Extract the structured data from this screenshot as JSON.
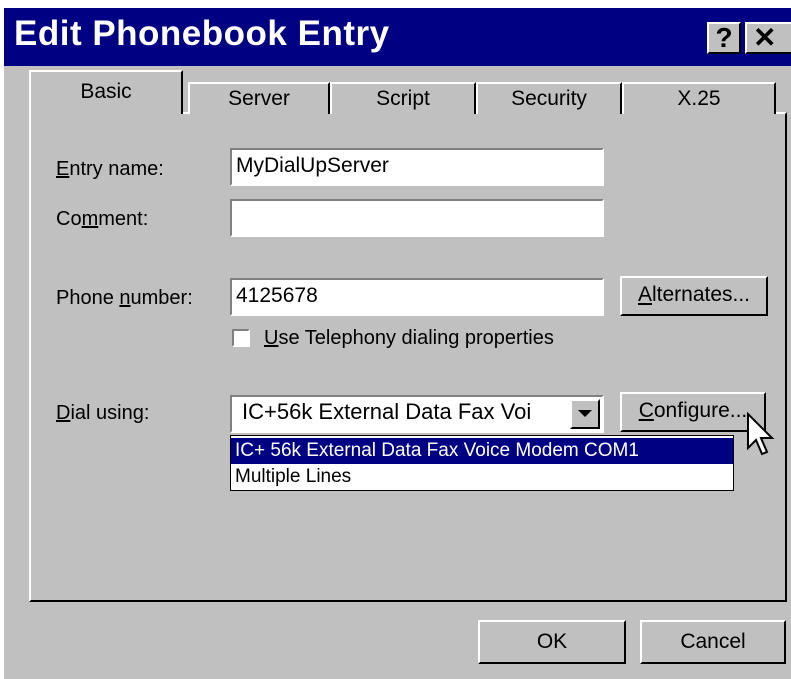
{
  "window": {
    "title": "Edit Phonebook Entry",
    "help_label": "?",
    "close_label": "✕"
  },
  "tabs": [
    {
      "label": "Basic",
      "active": true
    },
    {
      "label": "Server"
    },
    {
      "label": "Script"
    },
    {
      "label": "Security"
    },
    {
      "label": "X.25"
    }
  ],
  "form": {
    "entry_name_label_mn": "E",
    "entry_name_label_rest": "ntry name:",
    "entry_name_value": "MyDialUpServer",
    "comment_label_pre": "Co",
    "comment_label_mn": "m",
    "comment_label_rest": "ment:",
    "comment_value": "",
    "phone_label_pre": "Phone ",
    "phone_label_mn": "n",
    "phone_label_rest": "umber:",
    "phone_value": "4125678",
    "alternates_mn": "A",
    "alternates_rest": "lternates...",
    "telephony_mn": "U",
    "telephony_rest": "se Telephony dialing properties",
    "telephony_checked": false,
    "dial_label_mn": "D",
    "dial_label_rest": "ial using:",
    "dial_value": "IC+56k External Data Fax Voi",
    "configure_mn": "C",
    "configure_rest": "onfigure...",
    "dropdown_options": [
      "IC+ 56k External Data Fax Voice Modem   COM1",
      "Multiple Lines"
    ]
  },
  "footer": {
    "ok_label": "OK",
    "cancel_label": "Cancel"
  },
  "colors": {
    "titlebar": "#000082",
    "face": "#c0c0c0",
    "selection": "#000082"
  }
}
